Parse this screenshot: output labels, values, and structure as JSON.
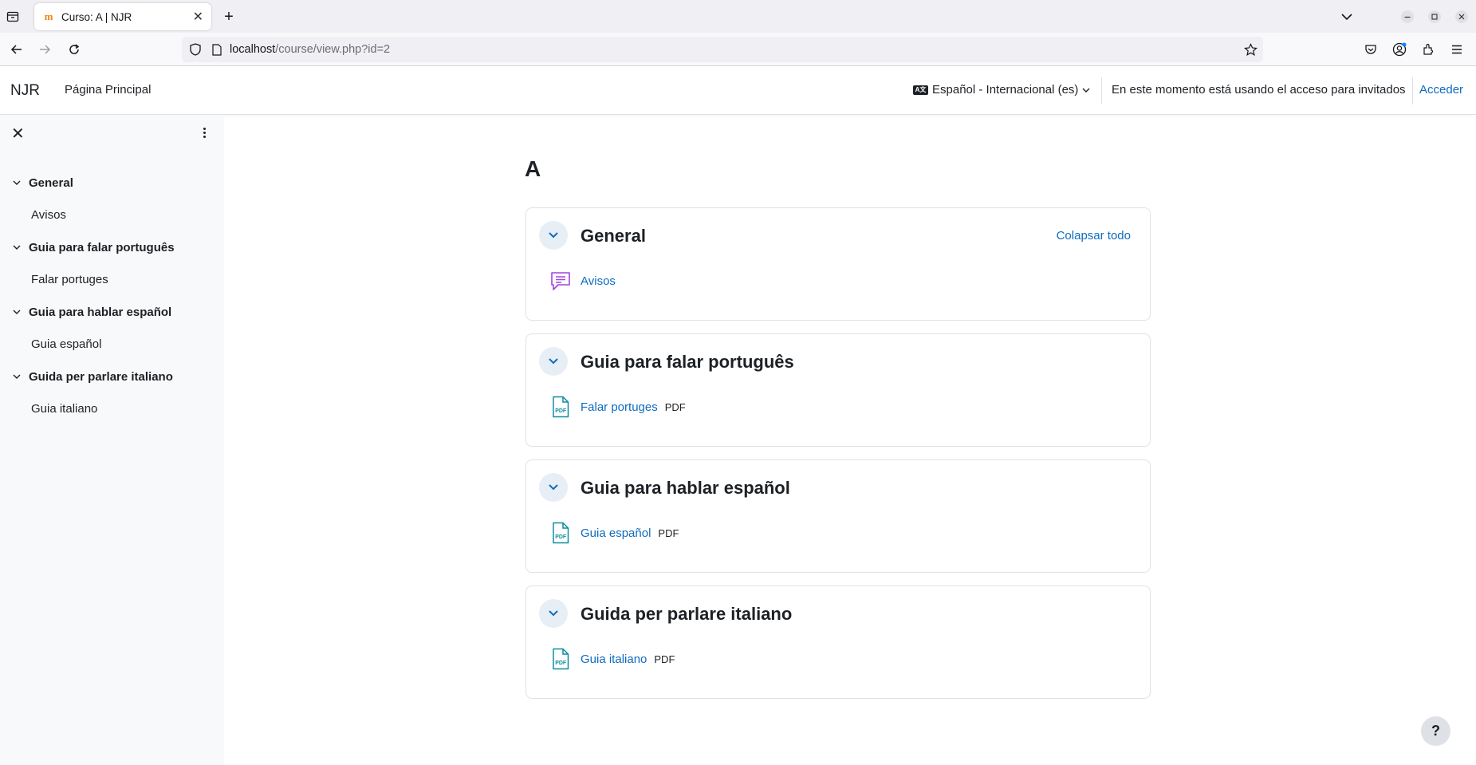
{
  "browser": {
    "tab_title": "Curso: A | NJR",
    "favicon_text": "m",
    "url_host": "localhost",
    "url_path": "/course/view.php?id=2"
  },
  "header": {
    "brand": "NJR",
    "home": "Página Principal",
    "language": "Español - Internacional (es)",
    "language_badge": "A文",
    "guest_notice": "En este momento está usando el acceso para invitados",
    "login": "Acceder"
  },
  "drawer": {
    "items": [
      {
        "section": "General",
        "activity": "Avisos"
      },
      {
        "section": "Guia para falar português",
        "activity": "Falar portuges"
      },
      {
        "section": "Guia para hablar español",
        "activity": "Guia español"
      },
      {
        "section": "Guida per parlare italiano",
        "activity": "Guia italiano"
      }
    ]
  },
  "course": {
    "title": "A",
    "collapse_all": "Colapsar todo",
    "sections": [
      {
        "title": "General",
        "activity": "Avisos",
        "type": "",
        "icon": "forum-icon"
      },
      {
        "title": "Guia para falar português",
        "activity": "Falar portuges",
        "type": "PDF",
        "icon": "pdf-icon"
      },
      {
        "title": "Guia para hablar español",
        "activity": "Guia español",
        "type": "PDF",
        "icon": "pdf-icon"
      },
      {
        "title": "Guida per parlare italiano",
        "activity": "Guia italiano",
        "type": "PDF",
        "icon": "pdf-icon"
      }
    ]
  },
  "help": "?",
  "colors": {
    "link": "#0f6cbf",
    "forum_icon": "#a244df",
    "pdf_icon": "#0d8ea0",
    "toggle_bg": "#e7eef6"
  }
}
